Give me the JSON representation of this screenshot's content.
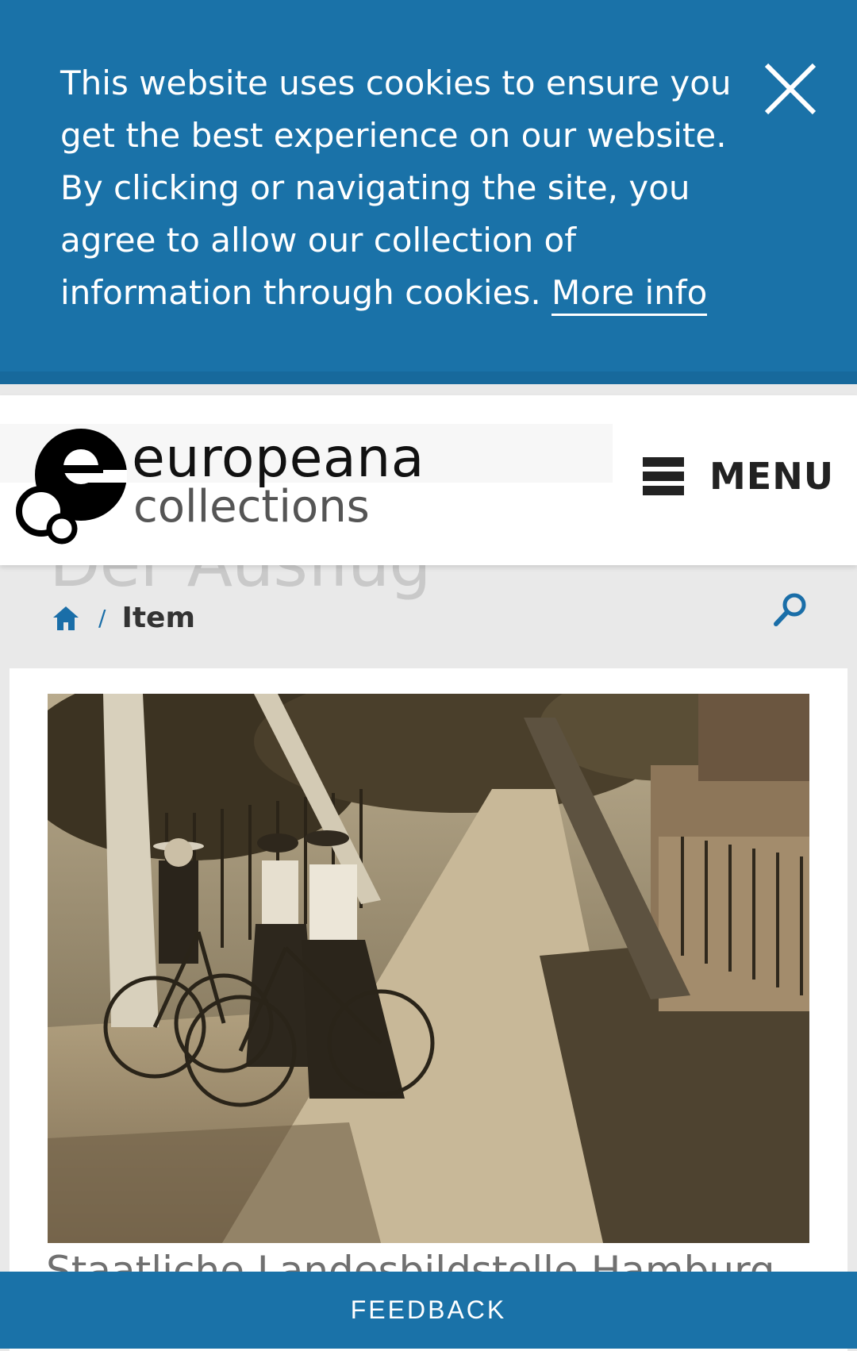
{
  "cookie_banner": {
    "message": "This website uses cookies to ensure you get the best experience on our website. By clicking or navigating the site, you agree to allow our collection of information through cookies.",
    "more_info_label": "More info",
    "close_icon": "close-icon"
  },
  "header": {
    "logo_primary": "europeana",
    "logo_secondary": "collections",
    "menu_label": "MENU",
    "menu_icon": "hamburger-icon"
  },
  "item": {
    "title": "Der Ausflug",
    "provider": "Staatliche Landesbildstelle Hamburg"
  },
  "breadcrumb": {
    "home_icon": "home-icon",
    "separator": "/",
    "current": "Item"
  },
  "search": {
    "icon": "search-icon"
  },
  "feedback": {
    "label": "FEEDBACK"
  },
  "colors": {
    "brand_blue": "#1a72a8",
    "link_blue": "#1a6ea8"
  }
}
